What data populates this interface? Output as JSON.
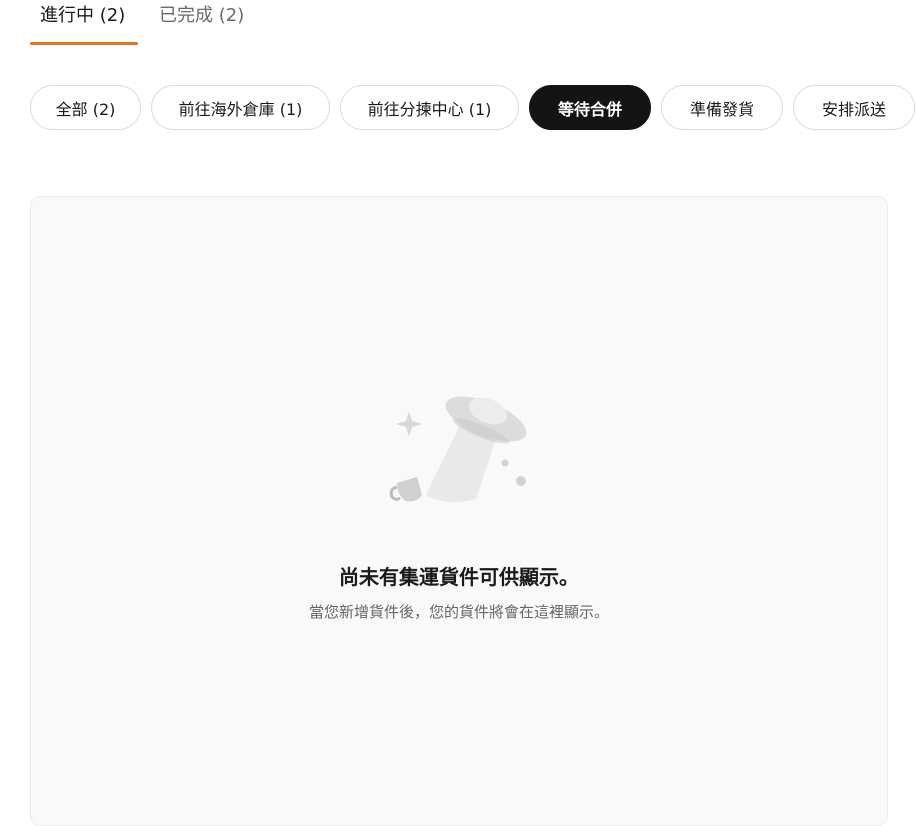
{
  "tabs": [
    {
      "label": "進行中 (2)",
      "active": true
    },
    {
      "label": "已完成 (2)",
      "active": false
    }
  ],
  "filters": [
    {
      "label": "全部 (2)",
      "selected": false
    },
    {
      "label": "前往海外倉庫 (1)",
      "selected": false
    },
    {
      "label": "前往分揀中心 (1)",
      "selected": false
    },
    {
      "label": "等待合併",
      "selected": true
    },
    {
      "label": "準備發貨",
      "selected": false
    },
    {
      "label": "安排派送",
      "selected": false
    }
  ],
  "empty_state": {
    "illustration": "ufo-illustration",
    "title": "尚未有集運貨件可供顯示。",
    "subtitle": "當您新增貨件後，您的貨件將會在這裡顯示。"
  },
  "colors": {
    "accent": "#e8741a",
    "chip_selected_bg": "#141414",
    "panel_bg": "#f9f9f9"
  }
}
